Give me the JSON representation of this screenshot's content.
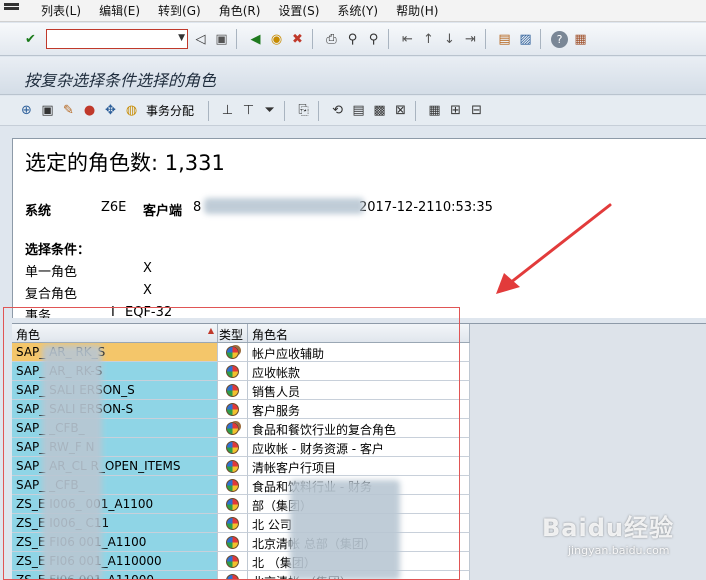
{
  "menu": {
    "items": [
      "列表(L)",
      "编辑(E)",
      "转到(G)",
      "角色(R)",
      "设置(S)",
      "系统(Y)",
      "帮助(H)"
    ]
  },
  "toolbar": {
    "command_value": "",
    "icons": [
      "enter-icon",
      "back-icon",
      "exit-icon",
      "cancel-icon",
      "print-icon",
      "find-icon",
      "find-next-icon",
      "first-page-icon",
      "prev-page-icon",
      "next-page-icon",
      "last-page-icon",
      "new-session-icon",
      "shortcut-icon",
      "help-icon",
      "layout-icon"
    ]
  },
  "page": {
    "title": "按复杂选择条件选择的角色"
  },
  "app_toolbar": {
    "transaction_assign_label": "事务分配"
  },
  "summary": {
    "count_line": "选定的角色数: 1,331",
    "system_label": "系统",
    "system_value": "Z6E",
    "client_label": "客户端",
    "client_value": "8",
    "timestamp": "2017-12-2110:53:35",
    "criteria_label": "选择条件：",
    "single_role_label": "单一角色",
    "single_role_value": "X",
    "composite_role_label": "复合角色",
    "composite_role_value": "X",
    "partial_label": "事务",
    "partial_i": "I",
    "partial_value": "EQF-32"
  },
  "grid": {
    "headers": {
      "role": "角色",
      "type": "类型",
      "role_name": "角色名"
    },
    "rows": [
      {
        "role": "SAP_      AR_     RK_S",
        "name": "帐户应收辅助",
        "multi": true,
        "selected": true
      },
      {
        "role": "SAP_      AR_     RK-S",
        "name": "应收帐款",
        "multi": false
      },
      {
        "role": "SAP_      SALI    ERSON_S",
        "name": "销售人员",
        "multi": false
      },
      {
        "role": "SAP_      SALI    ERSON-S",
        "name": "客户服务",
        "multi": false
      },
      {
        "role": "SAP_      _CFB_",
        "name": "食品和餐饮行业的复合角色",
        "multi": true
      },
      {
        "role": "SAP_      RW_F    N",
        "name": "应收帐 - 财务资源 - 客户",
        "multi": false
      },
      {
        "role": "SAP_      AR_CL   R_OPEN_ITEMS",
        "name": "清帐客户行项目",
        "multi": false
      },
      {
        "role": "SAP_      _CFB_",
        "name": "食品和饮料行业 - 财务",
        "multi": false
      },
      {
        "role": "ZS_E      I006_    001_A1100",
        "name": "                 部（集团）",
        "multi": false
      },
      {
        "role": "ZS_E      I006_    C11",
        "name": "北              公司",
        "multi": false
      },
      {
        "role": "ZS_E      FI06     001_A1100",
        "name": "北京清帐              总部（集团）",
        "multi": false
      },
      {
        "role": "ZS_E      FI06     001_A110000",
        "name": "北              （集团）",
        "multi": false
      },
      {
        "role": "ZS_E      FI06     001_A11000",
        "name": "北京清帐                （集团）",
        "multi": false
      }
    ]
  },
  "watermark": {
    "brand": "Baidu经验",
    "url": "jingyan.baidu.com"
  }
}
